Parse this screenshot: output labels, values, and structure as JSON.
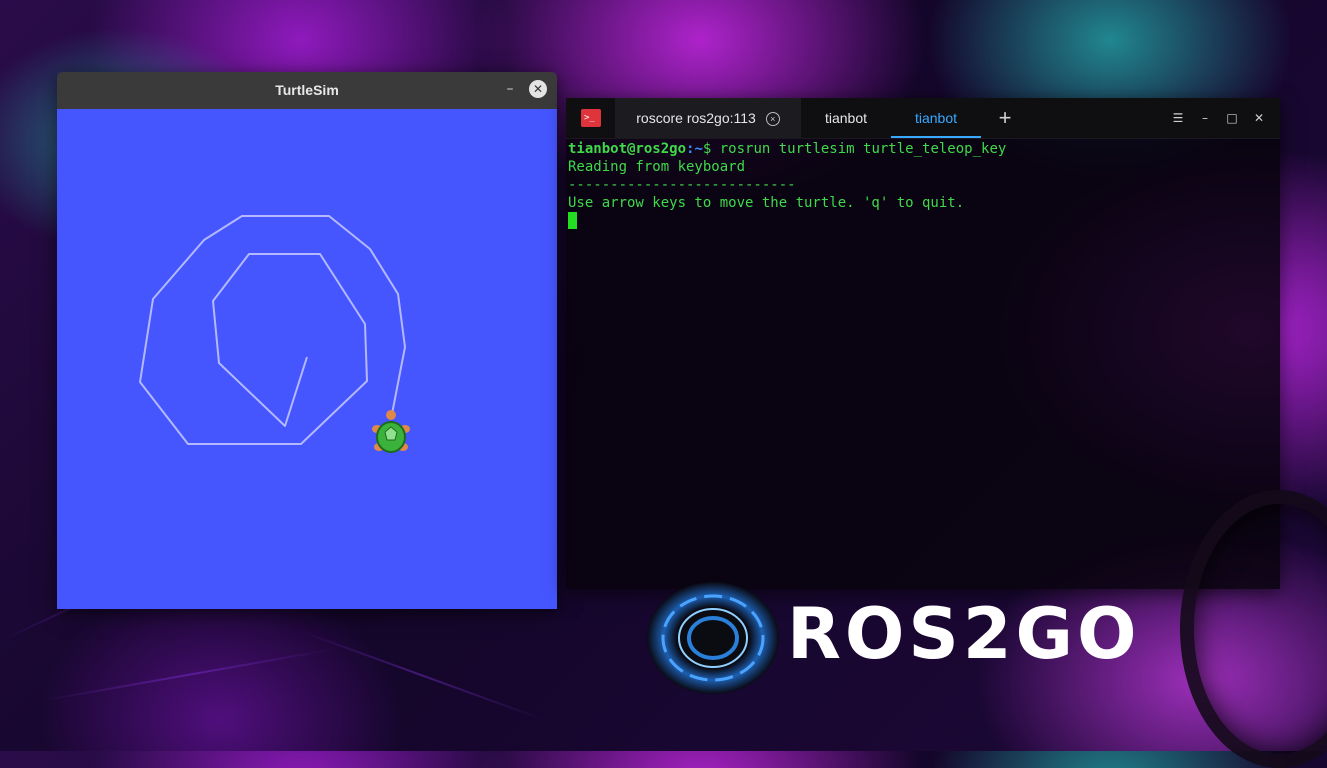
{
  "turtlesim": {
    "title": "TurtleSim",
    "minimize_glyph": "–",
    "close_glyph": "✕",
    "background_color": "#4556ff",
    "pen_color": "#b3b8ff"
  },
  "terminal": {
    "tabs": [
      {
        "label": "roscore ros2go:113",
        "active": false
      },
      {
        "label": "tianbot",
        "active": false
      },
      {
        "label": "tianbot",
        "active": true
      }
    ],
    "add_tab_glyph": "+",
    "tab_close_glyph": "×",
    "controls": {
      "menu": "☰",
      "minimize": "–",
      "maximize": "□",
      "close": "✕"
    },
    "prompt_user": "tianbot@ros2go",
    "prompt_path": ":~",
    "prompt_symbol": "$ ",
    "command": "rosrun turtlesim turtle_teleop_key",
    "output": [
      "Reading from keyboard",
      "---------------------------",
      "Use arrow keys to move the turtle. 'q' to quit."
    ],
    "accent_color": "#38a9ff",
    "text_color": "#3fd94a"
  },
  "logo": {
    "text": "ROS2GO"
  }
}
